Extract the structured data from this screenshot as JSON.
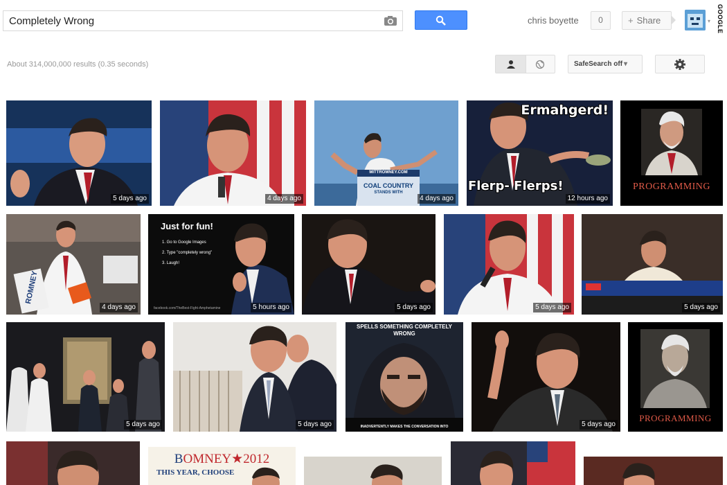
{
  "search": {
    "query": "Completely Wrong"
  },
  "header": {
    "user_name": "chris boyette",
    "notifications": "0",
    "share_label": "Share",
    "google_label": "GOOGLE"
  },
  "results": {
    "stats": "About 314,000,000 results (0.35 seconds)"
  },
  "toolbar": {
    "safesearch_label": "SafeSearch off",
    "safesearch_caret": "▾"
  },
  "images": {
    "r1": [
      {
        "age": "5 days ago"
      },
      {
        "age": "4 days ago"
      },
      {
        "age": "4 days ago",
        "sign_top": "MITTROMNEY.COM",
        "sign_main": "COAL COUNTRY",
        "sign_sub": "STANDS WITH"
      },
      {
        "age": "12 hours ago",
        "top_text": "Ermahgerd!",
        "bottom_text": "Flerp- Flerps!"
      },
      {
        "caption": "PROGRAMMING"
      }
    ],
    "r2": [
      {
        "age": "4 days ago",
        "sign_text": "ROMNEY"
      },
      {
        "age": "5 hours ago",
        "title": "Just for fun!",
        "steps": [
          "1. Go to Google Images",
          "2. Type \"completely wrong\"",
          "3. Laugh!"
        ],
        "footer": "facebook.com/TheBest-Fight-Amphetamine"
      },
      {
        "age": "5 days ago"
      },
      {
        "age": "5 days ago"
      },
      {
        "age": "5 days ago"
      }
    ],
    "r3": [
      {
        "age": "5 days ago"
      },
      {
        "age": "5 days ago"
      },
      {
        "top_text": "SPELLS SOMETHING COMPLETELY WRONG",
        "bottom_text": "INADVERTENTLY MAKES THE CONVERSATION INTO"
      },
      {
        "age": "5 days ago"
      },
      {
        "caption": "PROGRAMMING"
      }
    ],
    "r4": [
      {
        "age": ""
      },
      {
        "logo_b": "B",
        "logo_rest": "OMNEY",
        "logo_star": "★",
        "logo_year": "2012",
        "subtitle": "THIS YEAR, CHOOSE"
      },
      {
        "age": ""
      },
      {
        "age": ""
      },
      {
        "age": ""
      }
    ]
  }
}
